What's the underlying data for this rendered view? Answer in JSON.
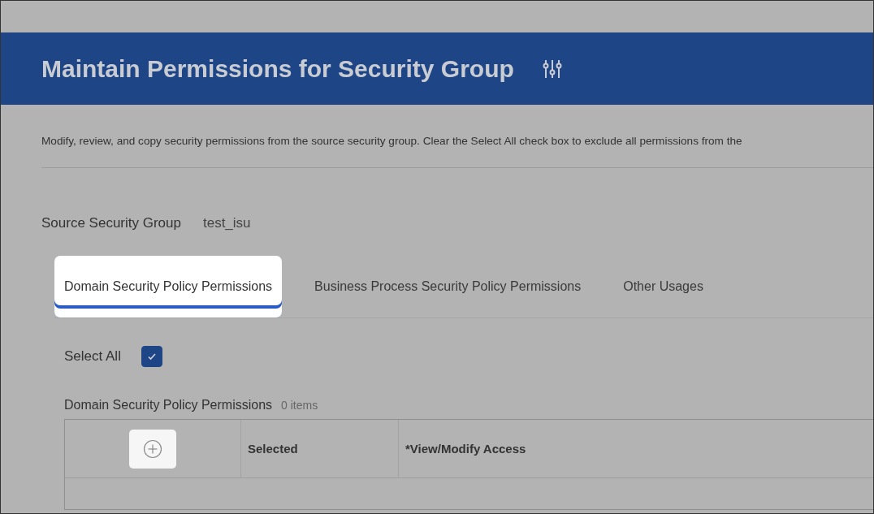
{
  "header": {
    "title": "Maintain Permissions for Security Group"
  },
  "description": "Modify, review, and copy security permissions from the source security group. Clear the Select All check box to exclude all permissions from the",
  "source_group": {
    "label": "Source Security Group",
    "value": "test_isu"
  },
  "tabs": [
    {
      "label": "Domain Security Policy Permissions",
      "selected": true
    },
    {
      "label": "Business Process Security Policy Permissions",
      "selected": false
    },
    {
      "label": "Other Usages",
      "selected": false
    }
  ],
  "select_all": {
    "label": "Select All",
    "checked": true
  },
  "table": {
    "title": "Domain Security Policy Permissions",
    "count": "0 items",
    "columns": [
      "Selected",
      "*View/Modify Access"
    ]
  }
}
